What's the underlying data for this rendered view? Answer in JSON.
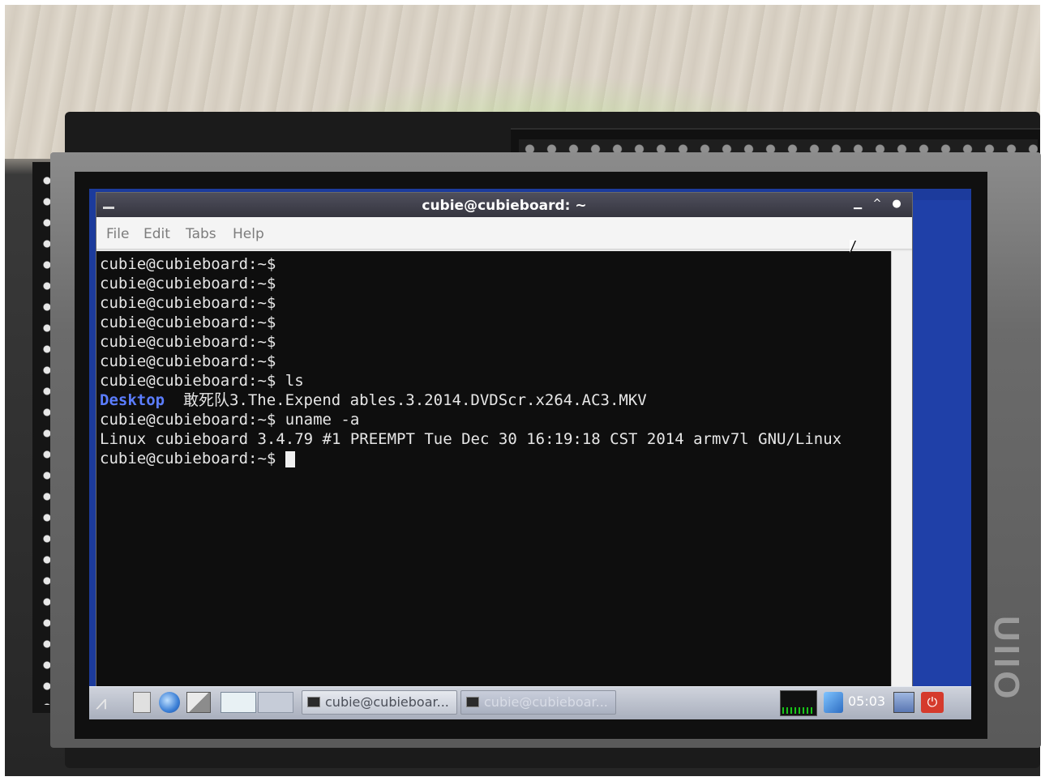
{
  "window": {
    "title": "cubie@cubieboard: ~",
    "controls": {
      "minimize": "▁",
      "maximize": "^",
      "close": "●"
    }
  },
  "menu": {
    "file": "File",
    "edit": "Edit",
    "tabs": "Tabs",
    "help": "Help"
  },
  "terminal": {
    "lines": [
      "cubie@cubieboard:~$",
      "cubie@cubieboard:~$",
      "cubie@cubieboard:~$",
      "cubie@cubieboard:~$",
      "cubie@cubieboard:~$",
      "cubie@cubieboard:~$",
      "cubie@cubieboard:~$ ls"
    ],
    "ls_output": {
      "dir": "Desktop",
      "file": "敢死队3.The.Expend ables.3.2014.DVDScr.x264.AC3.MKV"
    },
    "uname_cmd": "cubie@cubieboard:~$ uname -a",
    "uname_output": "Linux cubieboard 3.4.79 #1 PREEMPT Tue Dec 30 16:19:18 CST 2014 armv7l GNU/Linux",
    "prompt": "cubie@cubieboard:~$ "
  },
  "taskbar": {
    "tasks": [
      "cubie@cubieboar...",
      "cubie@cubieboar..."
    ],
    "clock": "05:03"
  },
  "colors": {
    "desktop": "#1c3b9c",
    "directory": "#5b7dff",
    "terminal_bg": "#0e0e0e"
  },
  "icons": [
    "start-menu-icon",
    "file-manager-icon",
    "browser-globe-icon",
    "show-windows-icon",
    "network-icon",
    "display-icon",
    "power-icon"
  ]
}
